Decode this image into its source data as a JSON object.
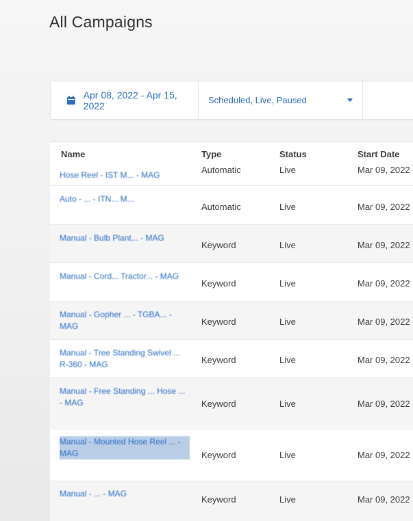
{
  "page_title": "All Campaigns",
  "filters": {
    "date_range": "Apr 08, 2022 - Apr 15, 2022",
    "status": "Scheduled, Live, Paused"
  },
  "table": {
    "headers": {
      "name": "Name",
      "type": "Type",
      "status": "Status",
      "start_date": "Start Date"
    },
    "rows": [
      {
        "name": "Hose Reel - IST M... - MAG",
        "type": "Automatic",
        "status": "Live",
        "start_date": "Mar 09, 2022"
      },
      {
        "name": "Auto - ... - ITN... M...",
        "type": "Automatic",
        "status": "Live",
        "start_date": "Mar 09, 2022"
      },
      {
        "name": "Manual - Bulb Plant... - MAG",
        "type": "Keyword",
        "status": "Live",
        "start_date": "Mar 09, 2022"
      },
      {
        "name": "Manual - Cord... Tractor... - MAG",
        "type": "Keyword",
        "status": "Live",
        "start_date": "Mar 09, 2022"
      },
      {
        "name": "Manual - Gopher ... - TGBA... - MAG",
        "type": "Keyword",
        "status": "Live",
        "start_date": "Mar 09, 2022"
      },
      {
        "name": "Manual - Tree Standing Swivel ... R-360 - MAG",
        "type": "Keyword",
        "status": "Live",
        "start_date": "Mar 09, 2022"
      },
      {
        "name": "Manual - Free Standing ... Hose ... - MAG",
        "type": "Keyword",
        "status": "Live",
        "start_date": "Mar 09, 2022"
      },
      {
        "name": "Manual - Mounted Hose Reel ... - MAG",
        "type": "Keyword",
        "status": "Live",
        "start_date": "Mar 09, 2022"
      },
      {
        "name": "Manual - ... - MAG",
        "type": "Keyword",
        "status": "Live",
        "start_date": "Mar 09, 2022"
      }
    ]
  }
}
